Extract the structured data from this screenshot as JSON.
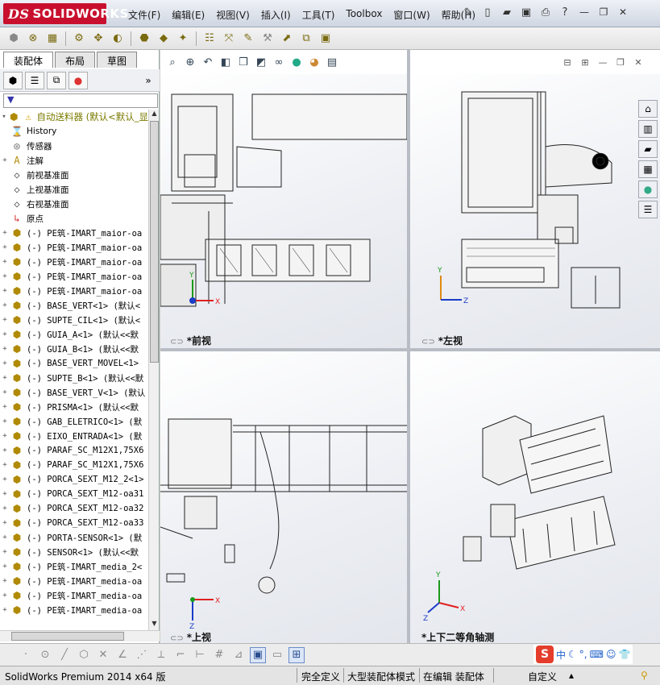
{
  "app": {
    "brand": "SOLIDWORKS",
    "brand_prefix": "DS",
    "menus": [
      "文件(F)",
      "编辑(E)",
      "视图(V)",
      "插入(I)",
      "工具(T)",
      "Toolbox",
      "窗口(W)",
      "帮助(H)"
    ]
  },
  "panel": {
    "tabs": [
      "装配体",
      "布局",
      "草图"
    ],
    "filter_glyph": "▼",
    "root": "自动送料器  (默认<默认_显",
    "tree": [
      {
        "icon": "history-icon",
        "glyph": "⌛",
        "label": "History",
        "expand": ""
      },
      {
        "icon": "sensor-icon",
        "glyph": "◎",
        "label": "传感器",
        "expand": ""
      },
      {
        "icon": "annotation-icon",
        "glyph": "A",
        "label": "注解",
        "expand": "+"
      },
      {
        "icon": "plane-icon",
        "glyph": "◇",
        "label": "前视基准面",
        "expand": ""
      },
      {
        "icon": "plane-icon",
        "glyph": "◇",
        "label": "上视基准面",
        "expand": ""
      },
      {
        "icon": "plane-icon",
        "glyph": "◇",
        "label": "右视基准面",
        "expand": ""
      },
      {
        "icon": "origin-icon",
        "glyph": "↳",
        "label": "原点",
        "expand": ""
      },
      {
        "icon": "part-icon",
        "glyph": "⬢",
        "label": "(-) PE筑-IMART_maior-oa",
        "expand": "+"
      },
      {
        "icon": "part-icon",
        "glyph": "⬢",
        "label": "(-) PE筑-IMART_maior-oa",
        "expand": "+"
      },
      {
        "icon": "part-icon",
        "glyph": "⬢",
        "label": "(-) PE筑-IMART_maior-oa",
        "expand": "+"
      },
      {
        "icon": "part-icon",
        "glyph": "⬢",
        "label": "(-) PE筑-IMART_maior-oa",
        "expand": "+"
      },
      {
        "icon": "part-icon",
        "glyph": "⬢",
        "label": "(-) PE筑-IMART_maior-oa",
        "expand": "+"
      },
      {
        "icon": "part-icon",
        "glyph": "⬢",
        "label": "(-) BASE_VERT<1> (默认<",
        "expand": "+"
      },
      {
        "icon": "part-icon",
        "glyph": "⬢",
        "label": "(-) SUPTE_CIL<1> (默认<",
        "expand": "+"
      },
      {
        "icon": "part-icon",
        "glyph": "⬢",
        "label": "(-) GUIA_A<1> (默认<<默",
        "expand": "+"
      },
      {
        "icon": "part-icon",
        "glyph": "⬢",
        "label": "(-) GUIA_B<1> (默认<<默",
        "expand": "+"
      },
      {
        "icon": "part-icon",
        "glyph": "⬢",
        "label": "(-) BASE_VERT_MOVEL<1>",
        "expand": "+"
      },
      {
        "icon": "part-icon",
        "glyph": "⬢",
        "label": "(-) SUPTE_B<1> (默认<<默",
        "expand": "+"
      },
      {
        "icon": "part-icon",
        "glyph": "⬢",
        "label": "(-) BASE_VERT_V<1> (默认",
        "expand": "+"
      },
      {
        "icon": "part-icon",
        "glyph": "⬢",
        "label": "(-) PRISMA<1> (默认<<默",
        "expand": "+"
      },
      {
        "icon": "part-icon",
        "glyph": "⬢",
        "label": "(-) GAB_ELETRICO<1> (默",
        "expand": "+"
      },
      {
        "icon": "part-icon",
        "glyph": "⬢",
        "label": "(-) EIXO_ENTRADA<1> (默",
        "expand": "+"
      },
      {
        "icon": "part-icon",
        "glyph": "⬢",
        "label": "(-) PARAF_SC_M12X1,75X6",
        "expand": "+"
      },
      {
        "icon": "part-icon",
        "glyph": "⬢",
        "label": "(-) PARAF_SC_M12X1,75X6",
        "expand": "+"
      },
      {
        "icon": "part-icon",
        "glyph": "⬢",
        "label": "(-) PORCA_SEXT_M12_2<1>",
        "expand": "+"
      },
      {
        "icon": "part-icon",
        "glyph": "⬢",
        "label": "(-) PORCA_SEXT_M12-oa31",
        "expand": "+"
      },
      {
        "icon": "part-icon",
        "glyph": "⬢",
        "label": "(-) PORCA_SEXT_M12-oa32",
        "expand": "+"
      },
      {
        "icon": "part-icon",
        "glyph": "⬢",
        "label": "(-) PORCA_SEXT_M12-oa33",
        "expand": "+"
      },
      {
        "icon": "part-icon",
        "glyph": "⬢",
        "label": "(-) PORTA-SENSOR<1> (默",
        "expand": "+"
      },
      {
        "icon": "part-icon",
        "glyph": "⬢",
        "label": "(-) SENSOR<1> (默认<<默",
        "expand": "+"
      },
      {
        "icon": "part-icon",
        "glyph": "⬢",
        "label": "(-) PE筑-IMART_media_2<",
        "expand": "+"
      },
      {
        "icon": "part-icon",
        "glyph": "⬢",
        "label": "(-) PE筑-IMART_media-oa",
        "expand": "+"
      },
      {
        "icon": "part-icon",
        "glyph": "⬢",
        "label": "(-) PE筑-IMART_media-oa",
        "expand": "+"
      },
      {
        "icon": "part-icon",
        "glyph": "⬢",
        "label": "(-) PE筑-IMART_media-oa",
        "expand": "+"
      }
    ]
  },
  "views": {
    "front": "*前视",
    "left": "*左视",
    "top": "*上视",
    "iso": "*上下二等角轴测",
    "axis_x": "X",
    "axis_y": "Y",
    "axis_z": "Z"
  },
  "ime": {
    "logo": "S",
    "mode": "中"
  },
  "status": {
    "version": "SolidWorks Premium 2014 x64 版",
    "definition": "完全定义",
    "mode": "大型装配体模式",
    "editing": "在编辑 装配体",
    "custom": "自定义"
  },
  "colors": {
    "brand": "#c8102e",
    "axis_x": "#e02020",
    "axis_y": "#1a9a1a",
    "axis_z": "#1a3cc8"
  }
}
